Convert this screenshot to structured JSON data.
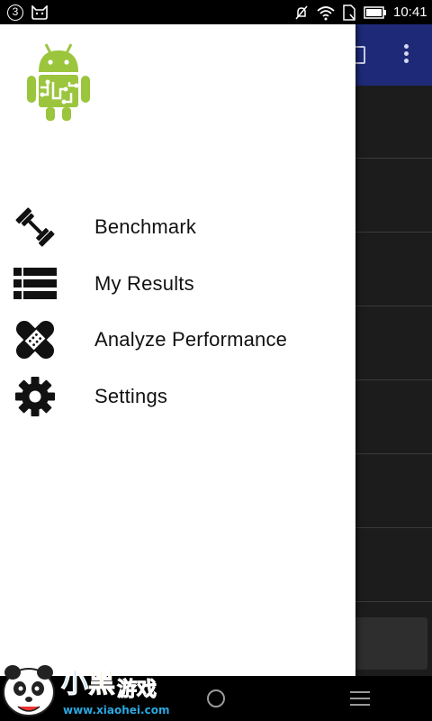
{
  "status_bar": {
    "notification_count": "3",
    "time": "10:41",
    "icons": [
      "cat-icon",
      "mute-icon",
      "wifi-icon",
      "sim-icon",
      "battery-icon"
    ]
  },
  "drawer": {
    "logo": "android-benchmark-logo",
    "items": [
      {
        "label": "Benchmark",
        "icon": "dumbbell-icon"
      },
      {
        "label": "My Results",
        "icon": "list-icon"
      },
      {
        "label": "Analyze Performance",
        "icon": "bandage-icon"
      },
      {
        "label": "Settings",
        "icon": "gear-icon"
      }
    ]
  },
  "colors": {
    "app_bar": "#1e2a78",
    "logo_green": "#9bc53d",
    "drawer_bg": "#ffffff",
    "text": "#111111"
  },
  "nav_bar": {
    "buttons": [
      "home-button",
      "menu-button"
    ]
  },
  "watermark": {
    "brand": "小黑游戏",
    "url": "www.xiaohei.com"
  }
}
